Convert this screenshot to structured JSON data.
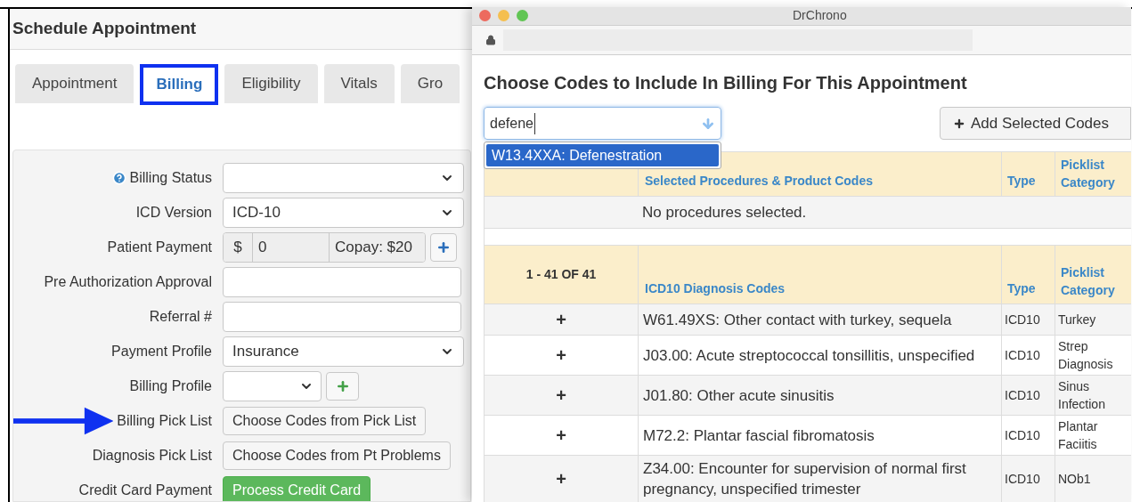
{
  "schedule": {
    "title": "Schedule Appointment",
    "tabs": [
      {
        "label": "Appointment",
        "selected": false
      },
      {
        "label": "Billing",
        "selected": true
      },
      {
        "label": "Eligibility",
        "selected": false
      },
      {
        "label": "Vitals",
        "selected": false
      },
      {
        "label": "Gro",
        "selected": false
      }
    ],
    "form": [
      {
        "kind": "select",
        "label": "Billing Status",
        "help": true,
        "annotated": false
      },
      {
        "kind": "select",
        "label": "ICD Version",
        "value": "ICD-10",
        "help": false,
        "annotated": false
      },
      {
        "kind": "payment",
        "label": "Patient Payment",
        "prefix": "$",
        "value": "0",
        "suffix": "Copay: $20",
        "help": false,
        "annotated": false
      },
      {
        "kind": "text",
        "label": "Pre Authorization Approval",
        "help": false,
        "annotated": false
      },
      {
        "kind": "text",
        "label": "Referral #",
        "help": false,
        "annotated": false
      },
      {
        "kind": "select",
        "label": "Payment Profile",
        "value": "Insurance",
        "help": false,
        "annotated": false
      },
      {
        "kind": "select_add",
        "label": "Billing Profile",
        "help": false,
        "annotated": false
      },
      {
        "kind": "button",
        "label": "Billing Pick List",
        "button": "Choose Codes from Pick List",
        "help": false,
        "annotated": true
      },
      {
        "kind": "button",
        "label": "Diagnosis Pick List",
        "button": "Choose Codes from Pt Problems",
        "help": false,
        "annotated": false
      },
      {
        "kind": "primary_button",
        "label": "Credit Card Payment",
        "button": "Process Credit Card",
        "help": false,
        "annotated": false
      }
    ]
  },
  "popup": {
    "window_title": "DrChrono",
    "heading": "Choose Codes to Include In Billing For This Appointment",
    "search": {
      "value": "defene"
    },
    "suggestions": [
      {
        "label": "W13.4XXA: Defenestration",
        "selected": true
      }
    ],
    "add_button": "Add Selected Codes",
    "selected_table": {
      "columns": [
        "Selected Procedures & Product Codes",
        "Type",
        "Picklist Category"
      ],
      "empty_message": "No procedures selected."
    },
    "diagnosis_table": {
      "count": "1 - 41 OF 41",
      "columns": [
        "ICD10 Diagnosis Codes",
        "Type",
        "Picklist Category"
      ],
      "rows": [
        {
          "add": "+",
          "description": "W61.49XS: Other contact with turkey, sequela",
          "type": "ICD10",
          "category": "Turkey"
        },
        {
          "add": "+",
          "description": "J03.00: Acute streptococcal tonsillitis, unspecified",
          "type": "ICD10",
          "category": "Strep Diagnosis"
        },
        {
          "add": "+",
          "description": "J01.80: Other acute sinusitis",
          "type": "ICD10",
          "category": "Sinus Infection"
        },
        {
          "add": "+",
          "description": "M72.2: Plantar fascial fibromatosis",
          "type": "ICD10",
          "category": "Plantar Faciitis"
        },
        {
          "add": "+",
          "description": "Z34.00: Encounter for supervision of normal first pregnancy, unspecified trimester",
          "type": "ICD10",
          "category": "NOb1"
        }
      ]
    }
  }
}
